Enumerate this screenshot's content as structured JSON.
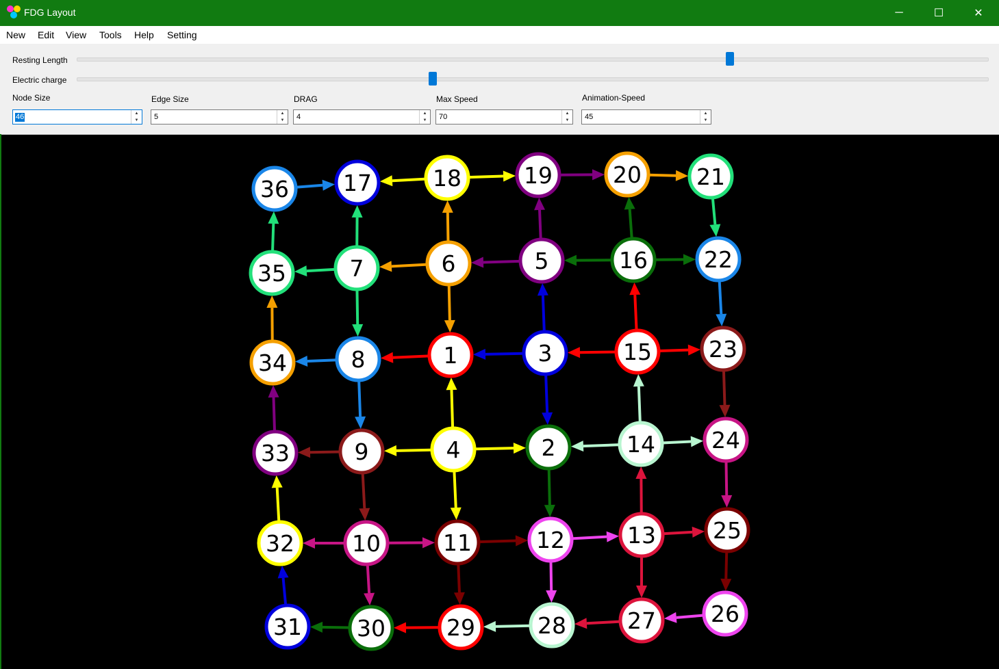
{
  "window": {
    "title": "FDG Layout",
    "minimize": "─",
    "maximize": "☐",
    "close": "✕"
  },
  "menu": [
    "New",
    "Edit",
    "View",
    "Tools",
    "Help",
    "Setting"
  ],
  "sliders": [
    {
      "label": "Resting Length",
      "value_fraction": 0.717
    },
    {
      "label": "Electric charge",
      "value_fraction": 0.391
    }
  ],
  "spinboxes": [
    {
      "label": "Node Size",
      "value": "46",
      "selected": true
    },
    {
      "label": "Edge Size",
      "value": "5",
      "selected": false
    },
    {
      "label": "DRAG",
      "value": "4",
      "selected": false
    },
    {
      "label": "Max Speed",
      "value": "70",
      "selected": false
    },
    {
      "label": "Animation-Speed",
      "value": "45",
      "selected": false
    }
  ],
  "colors": {
    "titlebar": "#117b11",
    "accent": "#0078d7"
  },
  "graph": {
    "nodes": [
      {
        "id": "1",
        "color": "#ff0000"
      },
      {
        "id": "2",
        "color": "#0a6e0a"
      },
      {
        "id": "3",
        "color": "#0000dd"
      },
      {
        "id": "4",
        "color": "#ffff00"
      },
      {
        "id": "5",
        "color": "#800080"
      },
      {
        "id": "6",
        "color": "#f5a000"
      },
      {
        "id": "7",
        "color": "#22e07a"
      },
      {
        "id": "8",
        "color": "#1a86e8"
      },
      {
        "id": "9",
        "color": "#8b1a1a"
      },
      {
        "id": "10",
        "color": "#c71585"
      },
      {
        "id": "11",
        "color": "#7a0000"
      },
      {
        "id": "12",
        "color": "#ee44ee"
      },
      {
        "id": "13",
        "color": "#dc143c"
      },
      {
        "id": "14",
        "color": "#b8f5d0"
      },
      {
        "id": "15",
        "color": "#ff0000"
      },
      {
        "id": "16",
        "color": "#0a6e0a"
      },
      {
        "id": "17",
        "color": "#0000dd"
      },
      {
        "id": "18",
        "color": "#ffff00"
      },
      {
        "id": "19",
        "color": "#800080"
      },
      {
        "id": "20",
        "color": "#f5a000"
      },
      {
        "id": "21",
        "color": "#22e07a"
      },
      {
        "id": "22",
        "color": "#1a86e8"
      },
      {
        "id": "23",
        "color": "#8b1a1a"
      },
      {
        "id": "24",
        "color": "#c71585"
      },
      {
        "id": "25",
        "color": "#7a0000"
      },
      {
        "id": "26",
        "color": "#ee44ee"
      },
      {
        "id": "27",
        "color": "#dc143c"
      },
      {
        "id": "28",
        "color": "#b8f5d0"
      },
      {
        "id": "29",
        "color": "#ff0000"
      },
      {
        "id": "30",
        "color": "#0a6e0a"
      },
      {
        "id": "31",
        "color": "#0000dd"
      },
      {
        "id": "32",
        "color": "#ffff00"
      },
      {
        "id": "33",
        "color": "#800080"
      },
      {
        "id": "34",
        "color": "#f5a000"
      },
      {
        "id": "35",
        "color": "#22e07a"
      },
      {
        "id": "36",
        "color": "#1a86e8"
      }
    ],
    "edges": [
      [
        "36",
        "17"
      ],
      [
        "18",
        "17"
      ],
      [
        "18",
        "19"
      ],
      [
        "19",
        "20"
      ],
      [
        "20",
        "21"
      ],
      [
        "21",
        "22"
      ],
      [
        "16",
        "20"
      ],
      [
        "16",
        "22"
      ],
      [
        "16",
        "5"
      ],
      [
        "5",
        "19"
      ],
      [
        "5",
        "6"
      ],
      [
        "6",
        "18"
      ],
      [
        "6",
        "7"
      ],
      [
        "6",
        "1"
      ],
      [
        "7",
        "17"
      ],
      [
        "7",
        "35"
      ],
      [
        "7",
        "8"
      ],
      [
        "35",
        "36"
      ],
      [
        "34",
        "35"
      ],
      [
        "8",
        "34"
      ],
      [
        "8",
        "9"
      ],
      [
        "1",
        "8"
      ],
      [
        "3",
        "1"
      ],
      [
        "3",
        "5"
      ],
      [
        "3",
        "2"
      ],
      [
        "15",
        "3"
      ],
      [
        "15",
        "16"
      ],
      [
        "15",
        "23"
      ],
      [
        "22",
        "23"
      ],
      [
        "4",
        "1"
      ],
      [
        "4",
        "9"
      ],
      [
        "4",
        "2"
      ],
      [
        "4",
        "11"
      ],
      [
        "9",
        "33"
      ],
      [
        "9",
        "10"
      ],
      [
        "33",
        "34"
      ],
      [
        "14",
        "15"
      ],
      [
        "14",
        "2"
      ],
      [
        "14",
        "24"
      ],
      [
        "2",
        "12"
      ],
      [
        "23",
        "24"
      ],
      [
        "24",
        "25"
      ],
      [
        "32",
        "33"
      ],
      [
        "10",
        "32"
      ],
      [
        "10",
        "11"
      ],
      [
        "10",
        "30"
      ],
      [
        "11",
        "12"
      ],
      [
        "11",
        "29"
      ],
      [
        "12",
        "13"
      ],
      [
        "12",
        "28"
      ],
      [
        "13",
        "14"
      ],
      [
        "13",
        "25"
      ],
      [
        "13",
        "27"
      ],
      [
        "25",
        "26"
      ],
      [
        "26",
        "27"
      ],
      [
        "27",
        "28"
      ],
      [
        "28",
        "29"
      ],
      [
        "29",
        "30"
      ],
      [
        "30",
        "31"
      ],
      [
        "31",
        "32"
      ]
    ]
  }
}
